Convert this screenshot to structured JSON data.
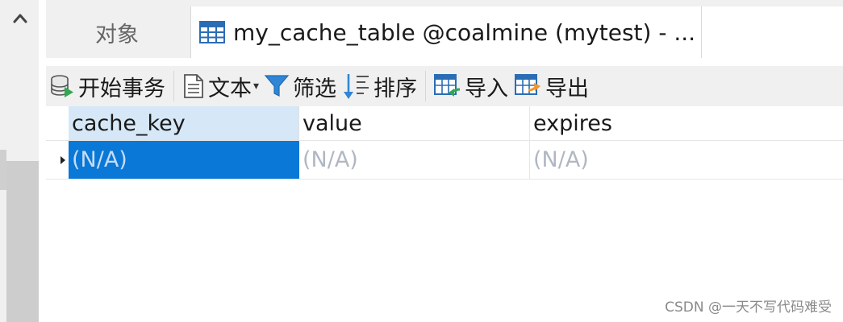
{
  "tabs": {
    "objects_label": "对象",
    "active_label": "my_cache_table @coalmine (mytest) - ..."
  },
  "toolbar": {
    "begin_transaction": "开始事务",
    "text": "文本",
    "filter": "筛选",
    "sort": "排序",
    "import": "导入",
    "export": "导出"
  },
  "grid": {
    "columns": [
      "cache_key",
      "value",
      "expires"
    ],
    "rows": [
      [
        "(N/A)",
        "(N/A)",
        "(N/A)"
      ]
    ]
  },
  "watermark": "CSDN @一天不写代码难受",
  "colors": {
    "selected_cell": "#0a78d7",
    "header_selected": "#d6e8f7",
    "null_text": "#b0b7c3"
  }
}
